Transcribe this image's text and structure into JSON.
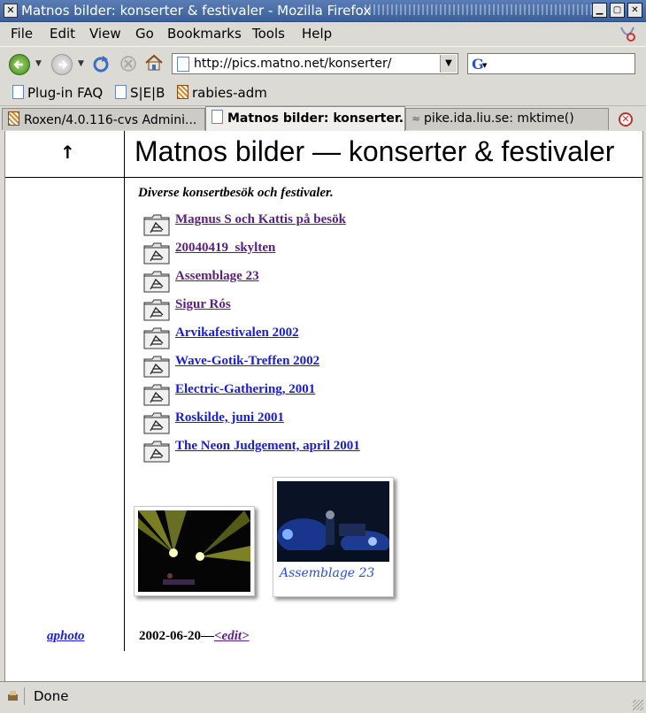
{
  "window": {
    "title": "Matnos bilder: konserter & festivaler - Mozilla Firefox"
  },
  "menu": [
    "File",
    "Edit",
    "View",
    "Go",
    "Bookmarks",
    "Tools",
    "Help"
  ],
  "nav": {
    "url": "http://pics.matno.net/konserter/",
    "search_value": ""
  },
  "bookmarks": [
    "Plug-in FAQ",
    "S|E|B",
    "rabies-adm"
  ],
  "tabs": [
    {
      "label": "Roxen/4.0.116-cvs Admini...",
      "active": false
    },
    {
      "label": "Matnos bilder: konserter...",
      "active": true
    },
    {
      "label": "pike.ida.liu.se: mktime()",
      "active": false
    }
  ],
  "page": {
    "up_arrow": "↑",
    "heading": "Matnos bilder — konserter & festivaler",
    "intro": "Diverse konsertbesök och festivaler.",
    "albums": [
      {
        "label": "Magnus S och Kattis på besök",
        "visited": true
      },
      {
        "label": "20040419_skylten",
        "visited": true
      },
      {
        "label": "Assemblage 23",
        "visited": true
      },
      {
        "label": "Sigur Rós",
        "visited": true
      },
      {
        "label": "Arvikafestivalen 2002",
        "visited": false
      },
      {
        "label": "Wave-Gotik-Treffen 2002",
        "visited": false
      },
      {
        "label": "Electric-Gathering, 2001",
        "visited": false
      },
      {
        "label": "Roskilde, juni 2001",
        "visited": false
      },
      {
        "label": "The Neon Judgement, april 2001",
        "visited": false
      }
    ],
    "thumbnails": [
      {
        "caption": ""
      },
      {
        "caption": "Assemblage 23"
      }
    ],
    "side_link": "aphoto",
    "footer": {
      "date": "2002-06-20—",
      "edit_link": "<edit>"
    }
  },
  "status": {
    "text": "Done"
  },
  "colors": {
    "link": "#1a1adb",
    "visited": "#5a1d83",
    "caption": "#2a4bd6",
    "titlebar": "#4a6ea8"
  }
}
